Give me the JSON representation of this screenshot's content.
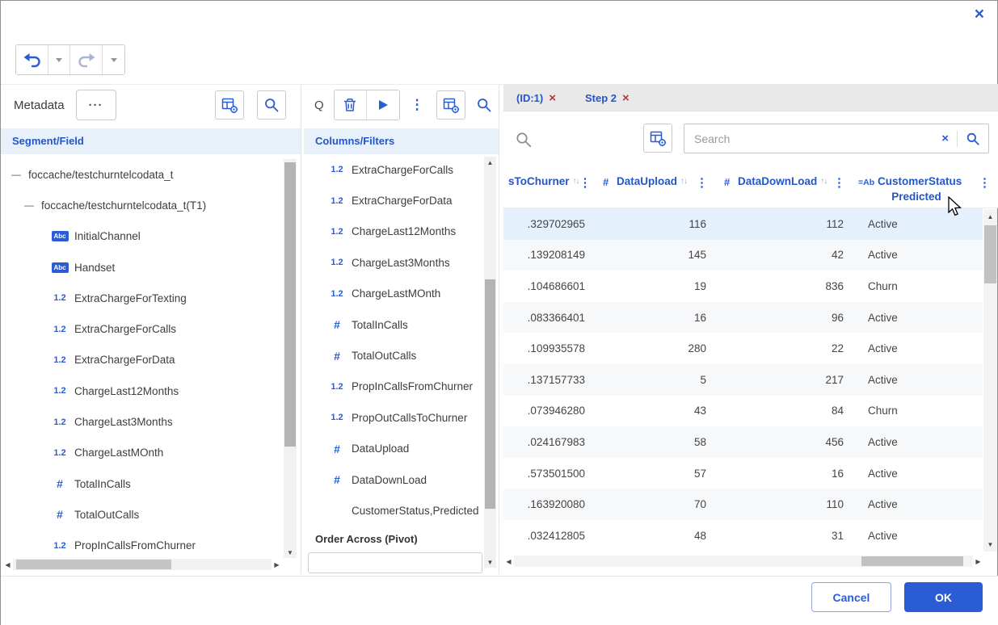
{
  "glyphs": {
    "close": "×",
    "kebab": "⋮",
    "sort": "↑↓",
    "collapse": "—",
    "more": "···",
    "left": "◀",
    "right": "▶",
    "up": "▲",
    "down": "▼",
    "alpha": "Abc",
    "integer": "#",
    "decimal": "1.2"
  },
  "left_panel": {
    "title": "Metadata",
    "section_header": "Segment/Field",
    "tree": [
      {
        "label": "foccache/testchurntelcodata_t",
        "level": 0,
        "icon": "collapse"
      },
      {
        "label": "foccache/testchurntelcodata_t(T1)",
        "level": 1,
        "icon": "collapse"
      },
      {
        "label": "InitialChannel",
        "level": 2,
        "icon": "alpha"
      },
      {
        "label": "Handset",
        "level": 2,
        "icon": "alpha"
      },
      {
        "label": "ExtraChargeForTexting",
        "level": 2,
        "icon": "decimal"
      },
      {
        "label": "ExtraChargeForCalls",
        "level": 2,
        "icon": "decimal"
      },
      {
        "label": "ExtraChargeForData",
        "level": 2,
        "icon": "decimal"
      },
      {
        "label": "ChargeLast12Months",
        "level": 2,
        "icon": "decimal"
      },
      {
        "label": "ChargeLast3Months",
        "level": 2,
        "icon": "decimal"
      },
      {
        "label": "ChargeLastMOnth",
        "level": 2,
        "icon": "decimal"
      },
      {
        "label": "TotalInCalls",
        "level": 2,
        "icon": "integer"
      },
      {
        "label": "TotalOutCalls",
        "level": 2,
        "icon": "integer"
      },
      {
        "label": "PropInCallsFromChurner",
        "level": 2,
        "icon": "decimal"
      }
    ]
  },
  "middle_panel": {
    "query_label": "Q",
    "section_header": "Columns/Filters",
    "order_across_label": "Order Across (Pivot)",
    "items": [
      {
        "label": "ExtraChargeForCalls",
        "icon": "decimal"
      },
      {
        "label": "ExtraChargeForData",
        "icon": "decimal"
      },
      {
        "label": "ChargeLast12Months",
        "icon": "decimal"
      },
      {
        "label": "ChargeLast3Months",
        "icon": "decimal"
      },
      {
        "label": "ChargeLastMOnth",
        "icon": "decimal"
      },
      {
        "label": "TotalInCalls",
        "icon": "integer"
      },
      {
        "label": "TotalOutCalls",
        "icon": "integer"
      },
      {
        "label": "PropInCallsFromChurner",
        "icon": "decimal"
      },
      {
        "label": "PropOutCallsToChurner",
        "icon": "decimal"
      },
      {
        "label": "DataUpload",
        "icon": "integer"
      },
      {
        "label": "DataDownLoad",
        "icon": "integer"
      },
      {
        "label": "CustomerStatus,Predicted",
        "icon": "matrix"
      }
    ]
  },
  "right_panel": {
    "tabs": [
      {
        "label": "(ID:1)"
      },
      {
        "label": "Step 2"
      }
    ],
    "search": {
      "placeholder": "Search"
    },
    "table": {
      "columns": [
        {
          "label": "sToChurner",
          "icon": "",
          "sortable": true
        },
        {
          "label": "DataUpload",
          "icon": "#",
          "sortable": true
        },
        {
          "label": "DataDownLoad",
          "icon": "#",
          "sortable": true
        },
        {
          "label": "CustomerStatus",
          "sublabel": "Predicted",
          "icon": "=Ab",
          "sortable": false
        }
      ],
      "rows": [
        [
          ".329702965",
          "116",
          "112",
          "Active"
        ],
        [
          ".139208149",
          "145",
          "42",
          "Active"
        ],
        [
          ".104686601",
          "19",
          "836",
          "Churn"
        ],
        [
          ".083366401",
          "16",
          "96",
          "Active"
        ],
        [
          ".109935578",
          "280",
          "22",
          "Active"
        ],
        [
          ".137157733",
          "5",
          "217",
          "Active"
        ],
        [
          ".073946280",
          "43",
          "84",
          "Churn"
        ],
        [
          ".024167983",
          "58",
          "456",
          "Active"
        ],
        [
          ".573501500",
          "57",
          "16",
          "Active"
        ],
        [
          ".163920080",
          "70",
          "110",
          "Active"
        ],
        [
          ".032412805",
          "48",
          "31",
          "Active"
        ]
      ],
      "selected_row_index": 0
    }
  },
  "footer": {
    "cancel_label": "Cancel",
    "ok_label": "OK"
  },
  "colors": {
    "accent": "#2a5cd6",
    "header_text": "#2456c5",
    "tab_close": "#b23b32",
    "row_highlight": "#e4f0fb",
    "panel_header_bg": "#e8f0fa"
  }
}
